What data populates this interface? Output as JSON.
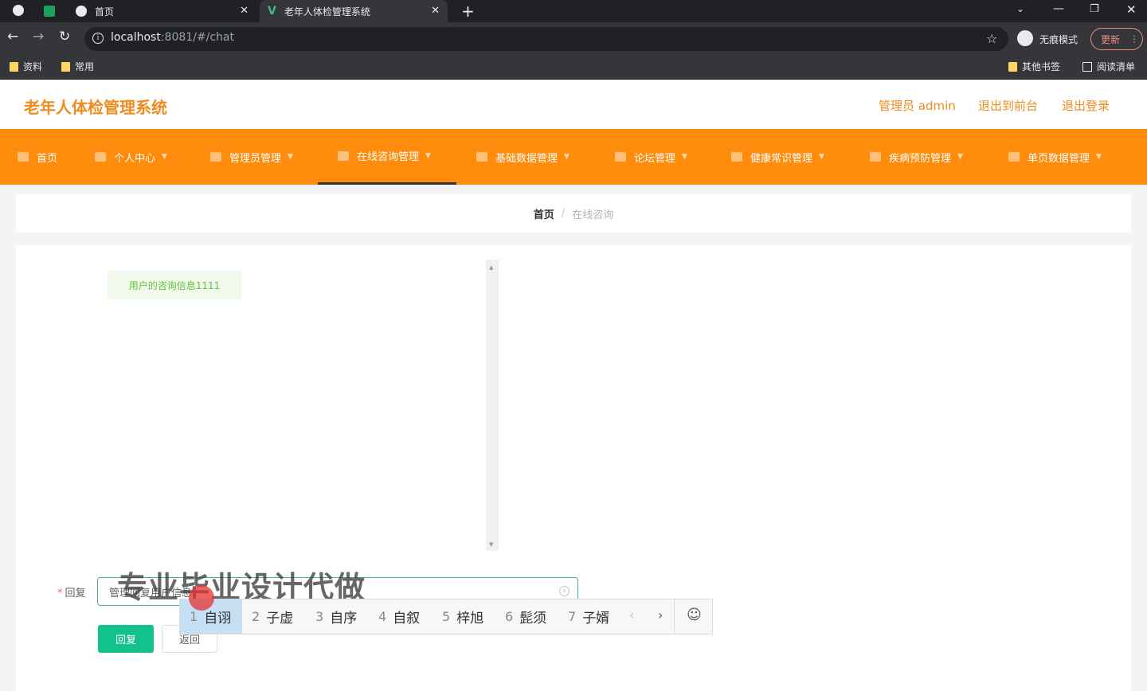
{
  "browser": {
    "tabs": [
      {
        "title": "首页"
      },
      {
        "title": "老年人体检管理系统"
      }
    ],
    "url_host": "localhost",
    "url_path": ":8081/#/chat",
    "incognito_label": "无痕模式",
    "update_label": "更新",
    "bookmarks": [
      {
        "label": "资料"
      },
      {
        "label": "常用"
      }
    ],
    "other_bookmarks": "其他书签",
    "reading_list": "阅读清单"
  },
  "header": {
    "title": "老年人体检管理系统",
    "admin_link": "管理员 admin",
    "front_link": "退出到前台",
    "logout_link": "退出登录"
  },
  "menu": [
    {
      "label": "首页"
    },
    {
      "label": "个人中心"
    },
    {
      "label": "管理员管理"
    },
    {
      "label": "在线咨询管理"
    },
    {
      "label": "基础数据管理"
    },
    {
      "label": "论坛管理"
    },
    {
      "label": "健康常识管理"
    },
    {
      "label": "疾病预防管理"
    },
    {
      "label": "单页数据管理"
    }
  ],
  "breadcrumb": {
    "home": "首页",
    "sep": "/",
    "current": "在线咨询"
  },
  "chat": {
    "messages": [
      {
        "text": "用户的咨询信息1111"
      }
    ]
  },
  "form": {
    "label": "回复",
    "required_mark": "*",
    "input_value": "管理回复用户信息",
    "submit_label": "回复",
    "back_label": "返回"
  },
  "watermark": "专业毕业设计代做",
  "ime": {
    "candidates": [
      {
        "num": "1",
        "text": "自诩"
      },
      {
        "num": "2",
        "text": "子虚"
      },
      {
        "num": "3",
        "text": "自序"
      },
      {
        "num": "4",
        "text": "自叙"
      },
      {
        "num": "5",
        "text": "梓旭"
      },
      {
        "num": "6",
        "text": "髭须"
      },
      {
        "num": "7",
        "text": "子婿"
      }
    ]
  },
  "colors": {
    "accent": "#ff8c0c",
    "title": "#f08b1e",
    "primary_button": "#13c28a",
    "bubble_text": "#67c23a"
  }
}
